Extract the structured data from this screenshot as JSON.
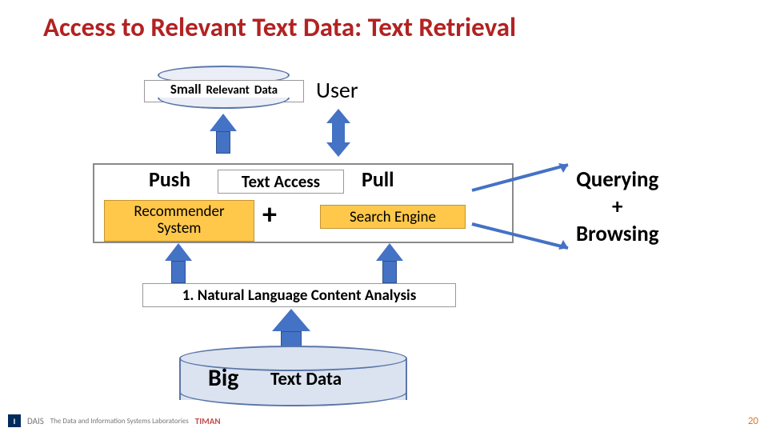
{
  "title": "Access to Relevant Text Data: Text Retrieval",
  "top": {
    "user": "User",
    "small": "Small",
    "relevant": "Relevant",
    "data": "Data"
  },
  "access": {
    "push": "Push",
    "pull": "Pull",
    "text_access": "Text Access",
    "recommender_l1": "Recommender",
    "recommender_l2": "System",
    "plus": "+",
    "search_engine": "Search Engine"
  },
  "side": {
    "querying": "Querying",
    "plus": "+",
    "browsing": "Browsing"
  },
  "nlca": "1. Natural Language Content Analysis",
  "bottom": {
    "big": "Big",
    "text_data": "Text Data"
  },
  "footer": {
    "dais": "DAIS",
    "timan": "TIMAN",
    "lab": "The Data and Information Systems Laboratories"
  },
  "page": "20"
}
